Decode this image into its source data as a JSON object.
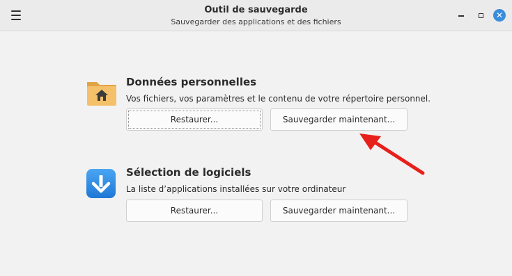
{
  "window": {
    "title": "Outil de sauvegarde",
    "subtitle": "Sauvegarder des applications et des fichiers",
    "controls": [
      "minimize-icon",
      "maximize-icon",
      "close-icon"
    ]
  },
  "sections": [
    {
      "icon": "home-folder-icon",
      "title": "Données personnelles",
      "description": "Vos fichiers, vos paramètres et le contenu de votre répertoire personnel.",
      "restore_label": "Restaurer...",
      "backup_label": "Sauvegarder maintenant..."
    },
    {
      "icon": "download-arrow-icon",
      "title": "Sélection de logiciels",
      "description": "La liste d’applications installées sur votre ordinateur",
      "restore_label": "Restaurer...",
      "backup_label": "Sauvegarder maintenant..."
    }
  ],
  "colors": {
    "accent_close": "#3a8ddb",
    "annotation_arrow": "#e8201b",
    "folder": "#f0b75a",
    "software_icon": "#2f8fe6"
  },
  "annotation": "red-arrow-pointing-at-backup-button"
}
